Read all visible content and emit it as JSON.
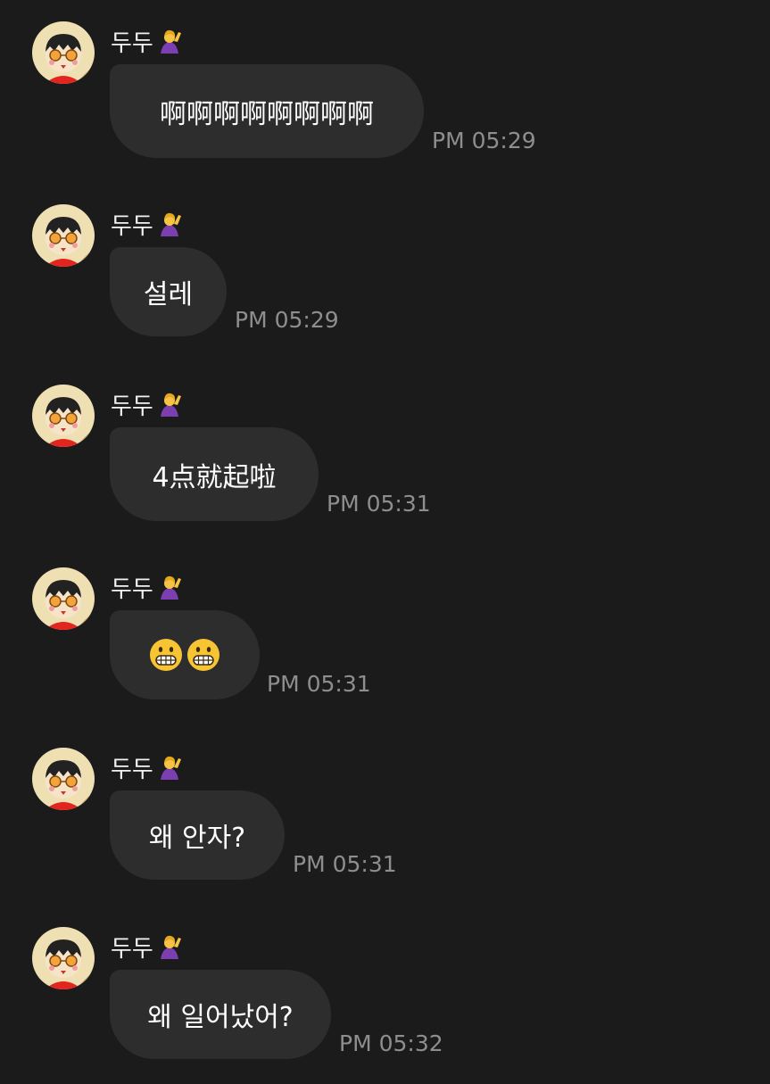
{
  "messages": [
    {
      "sender": "두두",
      "text": "啊啊啊啊啊啊啊啊",
      "time": "PM 05:29"
    },
    {
      "sender": "두두",
      "text": "설레",
      "time": "PM 05:29"
    },
    {
      "sender": "두두",
      "text": "4点就起啦",
      "time": "PM 05:31"
    },
    {
      "sender": "두두",
      "text": "",
      "emojis": [
        "grimacing-face",
        "grimacing-face"
      ],
      "time": "PM 05:31"
    },
    {
      "sender": "두두",
      "text": "왜 안자?",
      "time": "PM 05:31"
    },
    {
      "sender": "두두",
      "text": "왜 일어났어?",
      "time": "PM 05:32"
    }
  ],
  "icons": {
    "avatar": "cartoon-avatar-icon",
    "name_badge": "person-raising-hand-emoji"
  },
  "colors": {
    "background": "#1b1b1b",
    "bubble": "#2d2d2d",
    "time": "#8e8e8e"
  }
}
